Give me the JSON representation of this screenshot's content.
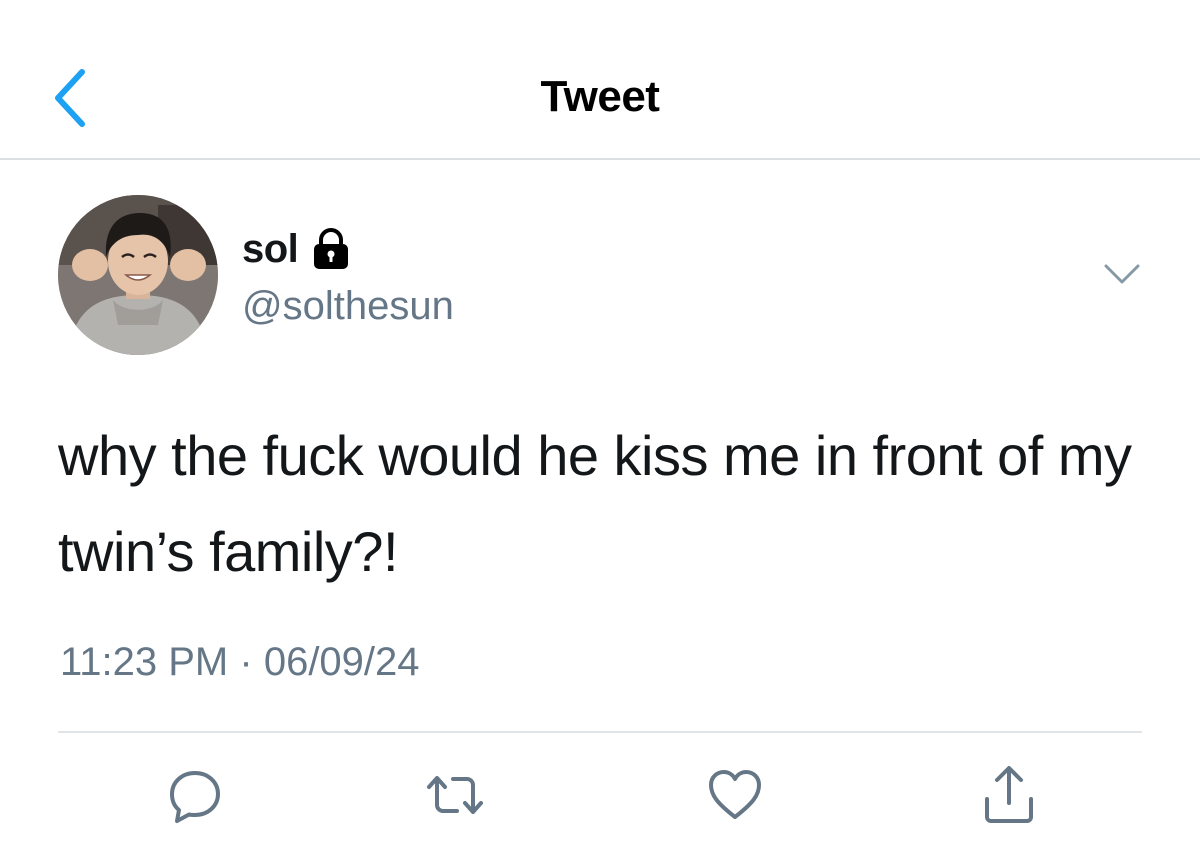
{
  "nav": {
    "title": "Tweet",
    "back_icon": "chevron-left-icon",
    "accent_color": "#1da1f2"
  },
  "tweet": {
    "author": {
      "display_name": "sol",
      "handle": "@solthesun",
      "protected_icon": "lock-icon"
    },
    "text": "why the fuck would he kiss me in front of my twin’s family?!",
    "time": "11:23 PM",
    "separator": "·",
    "date": "06/09/24",
    "more_icon": "chevron-down-icon"
  },
  "actions": [
    {
      "name": "reply",
      "icon": "reply-icon"
    },
    {
      "name": "retweet",
      "icon": "retweet-icon"
    },
    {
      "name": "like",
      "icon": "heart-icon"
    },
    {
      "name": "share",
      "icon": "share-icon"
    }
  ],
  "colors": {
    "text_primary": "#14171a",
    "text_secondary": "#657786",
    "divider": "#e1e4e7"
  }
}
